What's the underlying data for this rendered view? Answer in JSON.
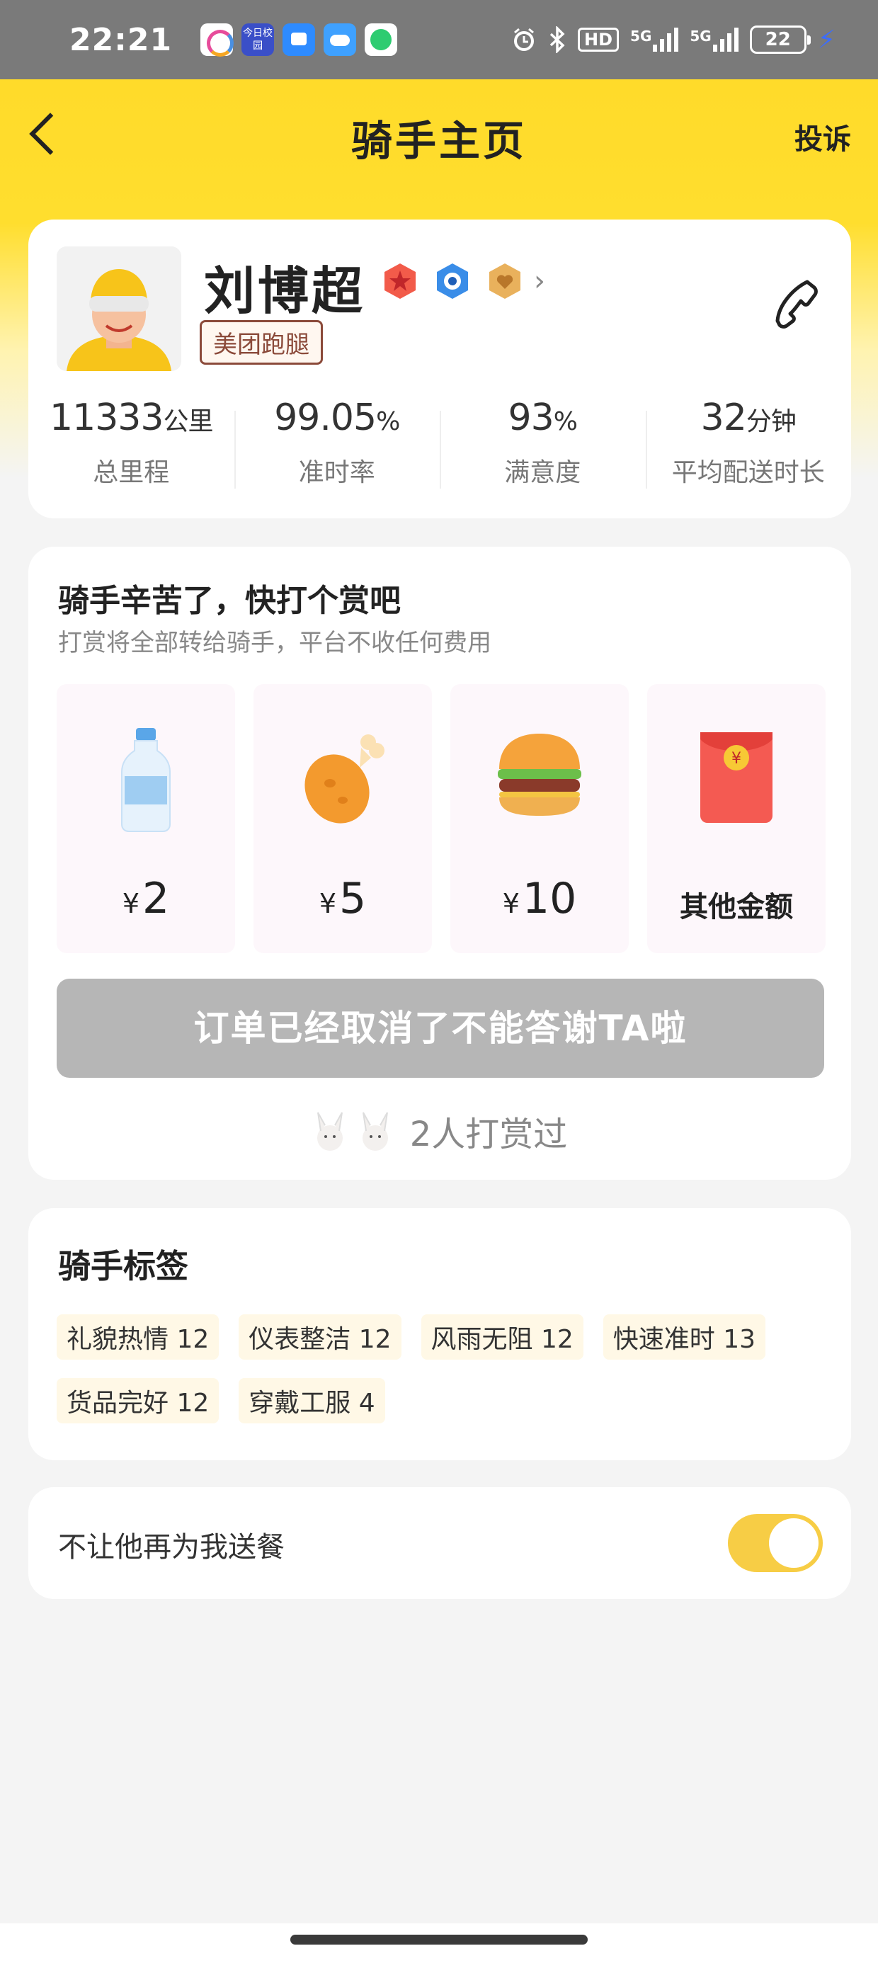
{
  "status_bar": {
    "time": "22:21",
    "hd_label": "HD",
    "signal_1": "5G",
    "signal_2": "5G",
    "battery": "22",
    "app_icon_2_text": "今日校园"
  },
  "nav": {
    "title": "骑手主页",
    "complain_label": "投诉"
  },
  "rider": {
    "name": "刘博超",
    "brand_tag": "美团跑腿",
    "badge_icons": [
      "red-star-badge-icon",
      "blue-ring-badge-icon",
      "gold-heart-badge-icon"
    ],
    "stats": [
      {
        "value": "11333",
        "unit": "公里",
        "label": "总里程"
      },
      {
        "value": "99.05",
        "unit": "%",
        "label": "准时率"
      },
      {
        "value": "93",
        "unit": "%",
        "label": "满意度"
      },
      {
        "value": "32",
        "unit": "分钟",
        "label": "平均配送时长"
      }
    ]
  },
  "tip": {
    "title": "骑手辛苦了，快打个赏吧",
    "subtitle": "打赏将全部转给骑手，平台不收任何费用",
    "currency": "¥",
    "options": [
      {
        "amount": "2",
        "icon": "water-bottle-icon"
      },
      {
        "amount": "5",
        "icon": "chicken-leg-icon"
      },
      {
        "amount": "10",
        "icon": "burger-icon"
      }
    ],
    "other_label": "其他金额",
    "other_icon": "red-envelope-icon",
    "button_label": "订单已经取消了不能答谢TA啦",
    "tippers_text": "2人打赏过"
  },
  "tags": {
    "title": "骑手标签",
    "items": [
      {
        "label": "礼貌热情 12"
      },
      {
        "label": "仪表整洁 12"
      },
      {
        "label": "风雨无阻 12"
      },
      {
        "label": "快速准时 13"
      },
      {
        "label": "货品完好 12"
      },
      {
        "label": "穿戴工服 4"
      }
    ]
  },
  "block": {
    "label": "不让他再为我送餐",
    "toggle_on": true,
    "toggle_color": "#f7cd45"
  },
  "colors": {
    "brand_yellow": "#ffd928",
    "disabled_button": "#b6b6b6",
    "brand_tag": "#8b4a3a"
  }
}
